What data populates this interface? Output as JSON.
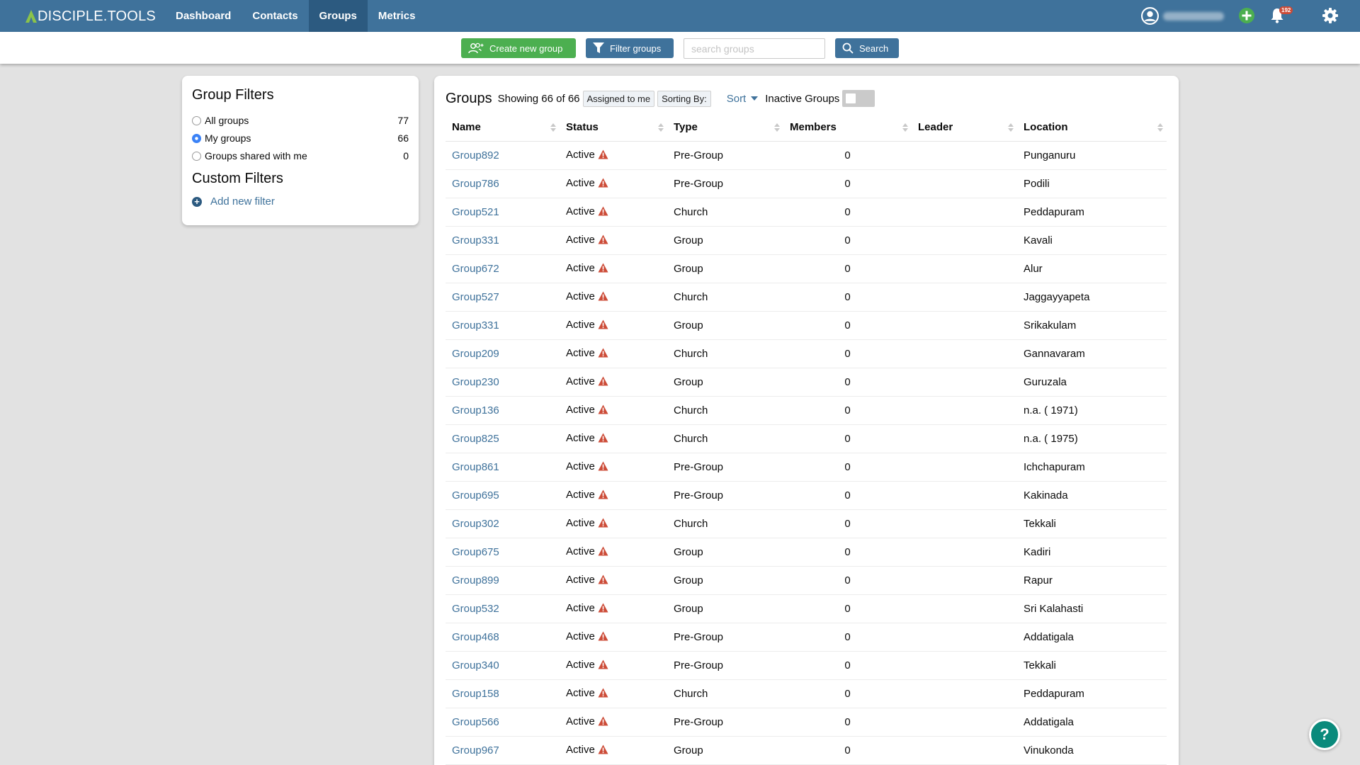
{
  "brand": {
    "name": "DISCIPLE.TOOLS"
  },
  "nav": {
    "items": [
      {
        "label": "Dashboard",
        "active": false
      },
      {
        "label": "Contacts",
        "active": false
      },
      {
        "label": "Groups",
        "active": true
      },
      {
        "label": "Metrics",
        "active": false
      }
    ],
    "notification_count": "192"
  },
  "toolbar": {
    "create_label": "Create new group",
    "filter_label": "Filter groups",
    "search_placeholder": "search groups",
    "search_label": "Search"
  },
  "filters": {
    "title": "Group Filters",
    "items": [
      {
        "label": "All groups",
        "count": "77",
        "checked": false
      },
      {
        "label": "My groups",
        "count": "66",
        "checked": true
      },
      {
        "label": "Groups shared with me",
        "count": "0",
        "checked": false
      }
    ],
    "custom_title": "Custom Filters",
    "add_label": "Add new filter"
  },
  "list": {
    "title": "Groups",
    "showing": "Showing 66 of 66",
    "chip_assigned": "Assigned to me",
    "chip_sorting": "Sorting By:",
    "sort_label": "Sort",
    "inactive_label": "Inactive Groups",
    "columns": [
      "Name",
      "Status",
      "Type",
      "Members",
      "Leader",
      "Location"
    ],
    "rows": [
      {
        "name": "Group892",
        "status": "Active",
        "type": "Pre-Group",
        "members": "0",
        "leader": "",
        "location": "Punganuru"
      },
      {
        "name": "Group786",
        "status": "Active",
        "type": "Pre-Group",
        "members": "0",
        "leader": "",
        "location": "Podili"
      },
      {
        "name": "Group521",
        "status": "Active",
        "type": "Church",
        "members": "0",
        "leader": "",
        "location": "Peddapuram"
      },
      {
        "name": "Group331",
        "status": "Active",
        "type": "Group",
        "members": "0",
        "leader": "",
        "location": "Kavali"
      },
      {
        "name": "Group672",
        "status": "Active",
        "type": "Group",
        "members": "0",
        "leader": "",
        "location": "Alur"
      },
      {
        "name": "Group527",
        "status": "Active",
        "type": "Church",
        "members": "0",
        "leader": "",
        "location": "Jaggayyapeta"
      },
      {
        "name": "Group331",
        "status": "Active",
        "type": "Group",
        "members": "0",
        "leader": "",
        "location": "Srikakulam"
      },
      {
        "name": "Group209",
        "status": "Active",
        "type": "Church",
        "members": "0",
        "leader": "",
        "location": "Gannavaram"
      },
      {
        "name": "Group230",
        "status": "Active",
        "type": "Group",
        "members": "0",
        "leader": "",
        "location": "Guruzala"
      },
      {
        "name": "Group136",
        "status": "Active",
        "type": "Church",
        "members": "0",
        "leader": "",
        "location": "n.a. ( 1971)"
      },
      {
        "name": "Group825",
        "status": "Active",
        "type": "Church",
        "members": "0",
        "leader": "",
        "location": "n.a. ( 1975)"
      },
      {
        "name": "Group861",
        "status": "Active",
        "type": "Pre-Group",
        "members": "0",
        "leader": "",
        "location": "Ichchapuram"
      },
      {
        "name": "Group695",
        "status": "Active",
        "type": "Pre-Group",
        "members": "0",
        "leader": "",
        "location": "Kakinada"
      },
      {
        "name": "Group302",
        "status": "Active",
        "type": "Church",
        "members": "0",
        "leader": "",
        "location": "Tekkali"
      },
      {
        "name": "Group675",
        "status": "Active",
        "type": "Group",
        "members": "0",
        "leader": "",
        "location": "Kadiri"
      },
      {
        "name": "Group899",
        "status": "Active",
        "type": "Group",
        "members": "0",
        "leader": "",
        "location": "Rapur"
      },
      {
        "name": "Group532",
        "status": "Active",
        "type": "Group",
        "members": "0",
        "leader": "",
        "location": "Sri Kalahasti"
      },
      {
        "name": "Group468",
        "status": "Active",
        "type": "Pre-Group",
        "members": "0",
        "leader": "",
        "location": "Addatigala"
      },
      {
        "name": "Group340",
        "status": "Active",
        "type": "Pre-Group",
        "members": "0",
        "leader": "",
        "location": "Tekkali"
      },
      {
        "name": "Group158",
        "status": "Active",
        "type": "Church",
        "members": "0",
        "leader": "",
        "location": "Peddapuram"
      },
      {
        "name": "Group566",
        "status": "Active",
        "type": "Pre-Group",
        "members": "0",
        "leader": "",
        "location": "Addatigala"
      },
      {
        "name": "Group967",
        "status": "Active",
        "type": "Group",
        "members": "0",
        "leader": "",
        "location": "Vinukonda"
      }
    ]
  },
  "help": {
    "label": "?"
  },
  "colors": {
    "nav": "#3f729b",
    "nav_active": "#2c5a80",
    "create": "#4caf50",
    "link": "#3f729b",
    "warning": "#cc4b37",
    "help": "#0a8a7c"
  }
}
